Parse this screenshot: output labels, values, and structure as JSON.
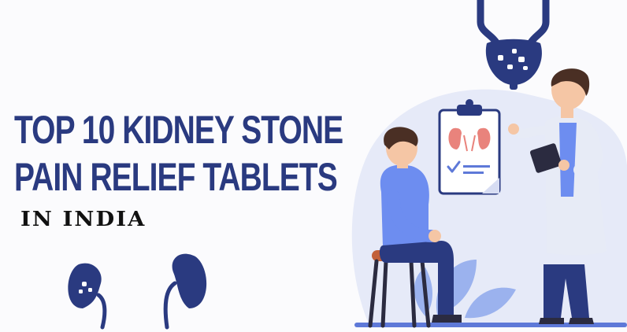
{
  "headline": {
    "line1": "TOP 10 KIDNEY STONE",
    "line2": "PAIN RELIEF TABLETS",
    "subtitle": "IN INDIA"
  },
  "colors": {
    "navy": "#2a3a80",
    "background": "#fbfbfd",
    "blob": "#e6eaf8",
    "shirt_blue": "#6d8df0",
    "skin": "#f5c6a5",
    "hair": "#4a2f24",
    "chair_seat": "#c2613a",
    "kidney_red": "#e9837c"
  },
  "icons": [
    "bladder-icon",
    "kidney-icon",
    "kidney-stone-icon",
    "clipboard-icon",
    "checkmark-icon",
    "leaf-icon"
  ]
}
